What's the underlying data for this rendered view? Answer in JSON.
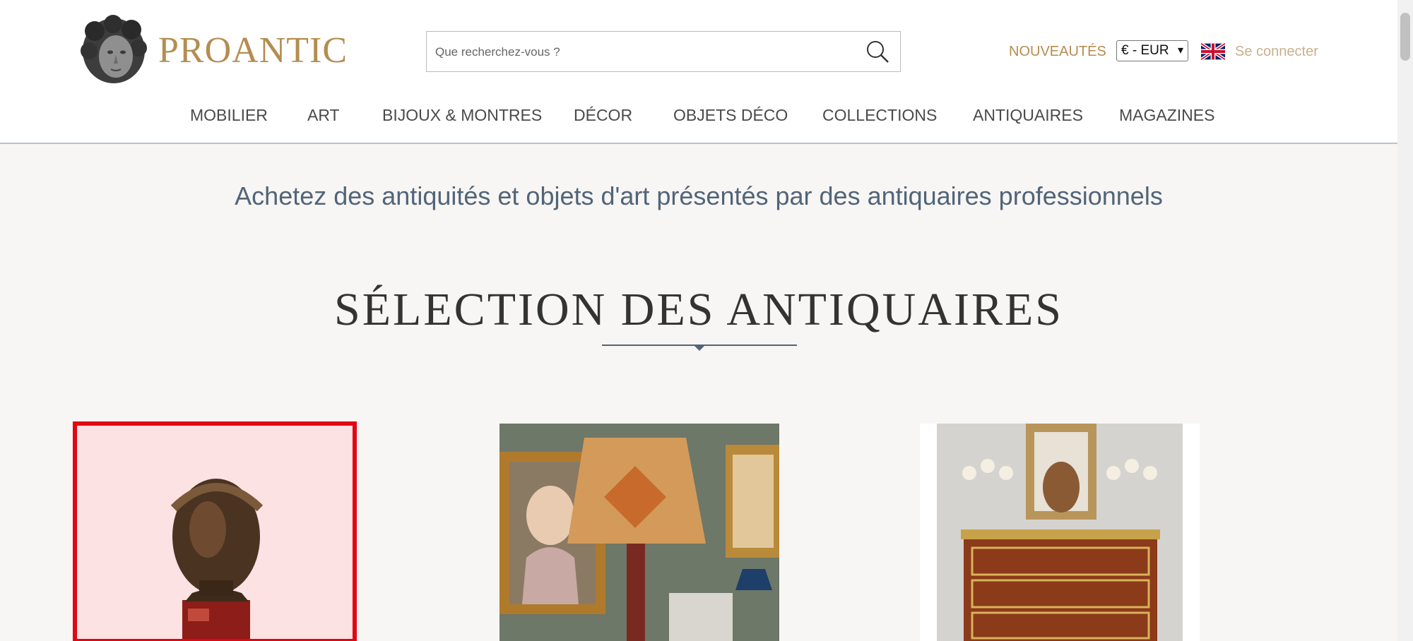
{
  "header": {
    "logo_text": "PROANTIC",
    "search": {
      "placeholder": "Que recherchez-vous ?",
      "value": ""
    },
    "new_label": "NOUVEAUTÉS",
    "currency": "€ - EUR",
    "login": "Se connecter"
  },
  "nav": [
    "MOBILIER",
    "ART",
    "BIJOUX & MONTRES",
    "DÉCOR",
    "OBJETS DÉCO",
    "COLLECTIONS",
    "ANTIQUAIRES",
    "MAGAZINES"
  ],
  "main": {
    "tagline": "Achetez des antiquités et objets d'art présentés par des antiquaires professionnels",
    "section_title": "SÉLECTION DES ANTIQUAIRES"
  },
  "colors": {
    "gold": "#b48d4f",
    "highlight": "#e30613",
    "slate": "#526478"
  }
}
